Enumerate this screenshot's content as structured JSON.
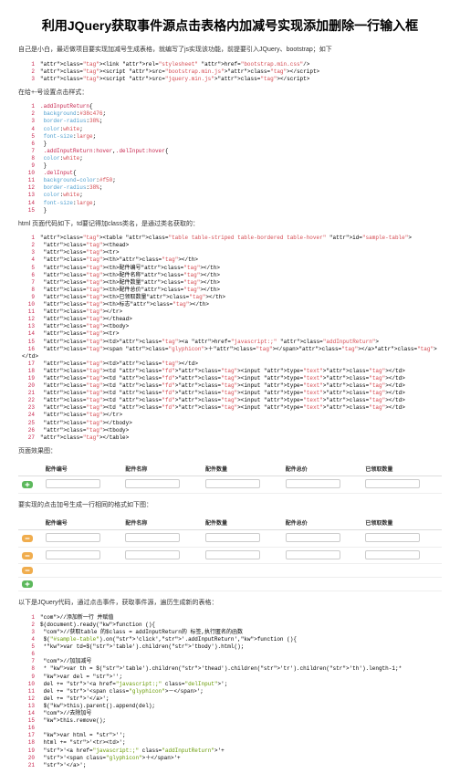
{
  "title": "利用JQuery获取事件源点击表格内加减号实现添加删除一行输入框",
  "intro": "自己是小白，最近做项目要实现加减号生成表格，就编写了js实现该功能，前提要引入JQuery、bootstrap；如下",
  "code1": [
    "<link rel=\"stylesheet\" href=\"bootstrap.min.css\"/>",
    "<script src=\"bootstrap.min.js\"></script>",
    "<script src=\"jquery.min.js\"></script>"
  ],
  "para2": "在给+-号设置点击样式：",
  "css_lines": [
    ".addInputReturn{",
    "        background:#38c476;",
    "        border-radius:38%;",
    "        color:white;",
    "        font-size:large;",
    "    }",
    "    .addInputReturn:hover,.delInput:hover{",
    "        color:white;",
    "    }",
    "    .delInput{",
    "        background-color:#f50;",
    "        border-radius:38%;",
    "        color:white;",
    "        font-size:large;",
    "    }"
  ],
  "para3": "html 页面代码如下，td要记得加class类名，是通过类名获取的：",
  "html_lines": [
    "<table class=\"table table-striped table-bordered table-hover\" id=\"sample-table\">",
    "    <thead>",
    "        <tr>",
    "            <th></th>",
    "            <th>配件编号</th>",
    "            <th>配件名称</th>",
    "            <th>配件数量</th>",
    "            <th>配件总价</th>",
    "            <th>已领取数量</th>",
    "            <th>标志</th>",
    "        </tr>",
    "    </thead>",
    "    <tbody>",
    "        <tr>",
    "            <td><a href=\"javascript:;\" class=\"addInputReturn\">",
    "                <span class=\"glyphicon\">＋</span></a></td>",
    "            <td></td>",
    "            <td class=\"fd\"><input type=\"text\"></td>",
    "            <td class=\"fd\"><input type=\"text\"></td>",
    "            <td class=\"fd\"><input type=\"text\"></td>",
    "            <td class=\"fd\"><input type=\"text\"></td>",
    "            <td class=\"fd\"><input type=\"text\"></td>",
    "            <td class=\"fd\"><input type=\"text\"></td>",
    "        </tr>",
    "    </tbody>",
    "    <tbody>",
    "</table>"
  ],
  "para4": "页面效果图：",
  "table1": {
    "headers": [
      "",
      "配件编号",
      "配件名称",
      "配件数量",
      "配件总价",
      "已领取数量"
    ]
  },
  "para5": "要实现的点击加号生成一行相同的格式如下图：",
  "table2": {
    "headers": [
      "",
      "配件编号",
      "配件名称",
      "配件数量",
      "配件总价",
      "已领取数量"
    ]
  },
  "para6": "以下是JQuery代码，通过点击事件，获取事件源，遍历生成新的表格：",
  "js_lines": [
    "//添加新一行 并赋值",
    "$(document).ready(function (){",
    "  //获取table 的$class = addInputReturn的 标签,执行匿名的函数",
    "  $(\"#sample-table\").on('click','.addInputReturn',function (){",
    "     *var td=$('table').children('tbody').html();",
    "",
    "    //加加减号",
    "    * var th = $('table').children('thead').children('tr').children('th').length-1;*",
    "    var del = '';",
    "    del += '<a href=\"javascript:;\" class=\"delInput\">';",
    "    del += '<span class=\"glyphicon\">－</span>';",
    "    del += '</a>';",
    "    $(this).parent().append(del);",
    "    //去除加号",
    "    this.remove();",
    "",
    "    var html = '';",
    "    html += '<tr><td>';",
    "        '<a href=\"javascript:;\" class=\"addInputReturn\">'+",
    "            '<span class=\"glyphicon\">＋</span>'+",
    "        '</a>';"
  ]
}
